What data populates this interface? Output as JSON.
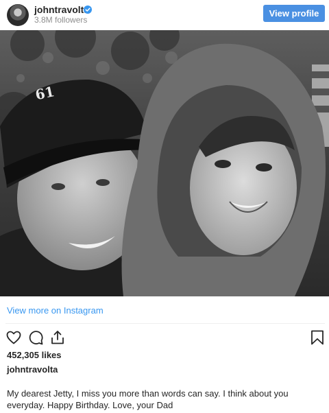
{
  "header": {
    "username": "johntravolta",
    "followers": "3.8M followers",
    "view_profile_label": "View profile",
    "verified_icon": "verified-badge-icon",
    "colors": {
      "button": "#4a90e2",
      "verified": "#3897f0"
    }
  },
  "post": {
    "view_more_label": "View more on Instagram",
    "likes": "452,305 likes",
    "author": "johntravolta",
    "caption": "My dearest Jetty, I miss you more than words can say. I think about you everyday. Happy Birthday. Love, your Dad",
    "icons": {
      "like": "heart-icon",
      "comment": "comment-icon",
      "share": "share-icon",
      "save": "bookmark-icon"
    }
  }
}
